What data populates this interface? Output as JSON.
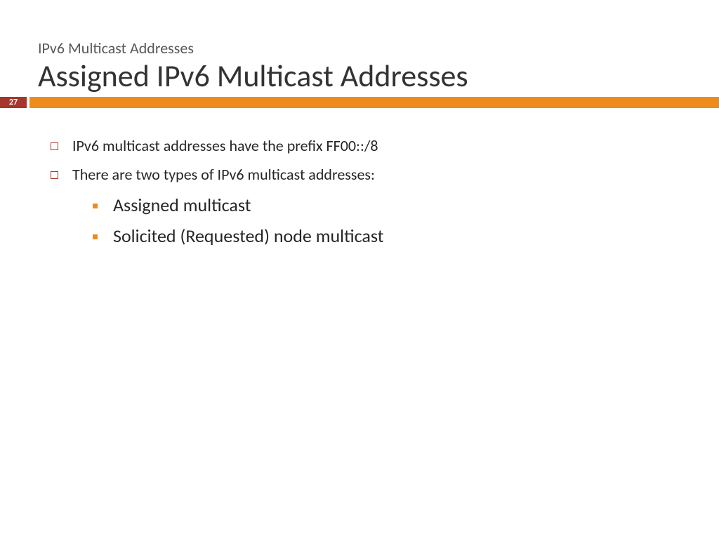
{
  "header": {
    "subtitle": "IPv6 Multicast Addresses",
    "title": "Assigned IPv6 Multicast Addresses",
    "page_number": "27"
  },
  "bullets": {
    "b1": "IPv6 multicast addresses have the prefix FF00::/8",
    "b2": "There are two types of IPv6 multicast addresses:",
    "sub1": "Assigned multicast",
    "sub2": "Solicited (Requested) node multicast"
  }
}
